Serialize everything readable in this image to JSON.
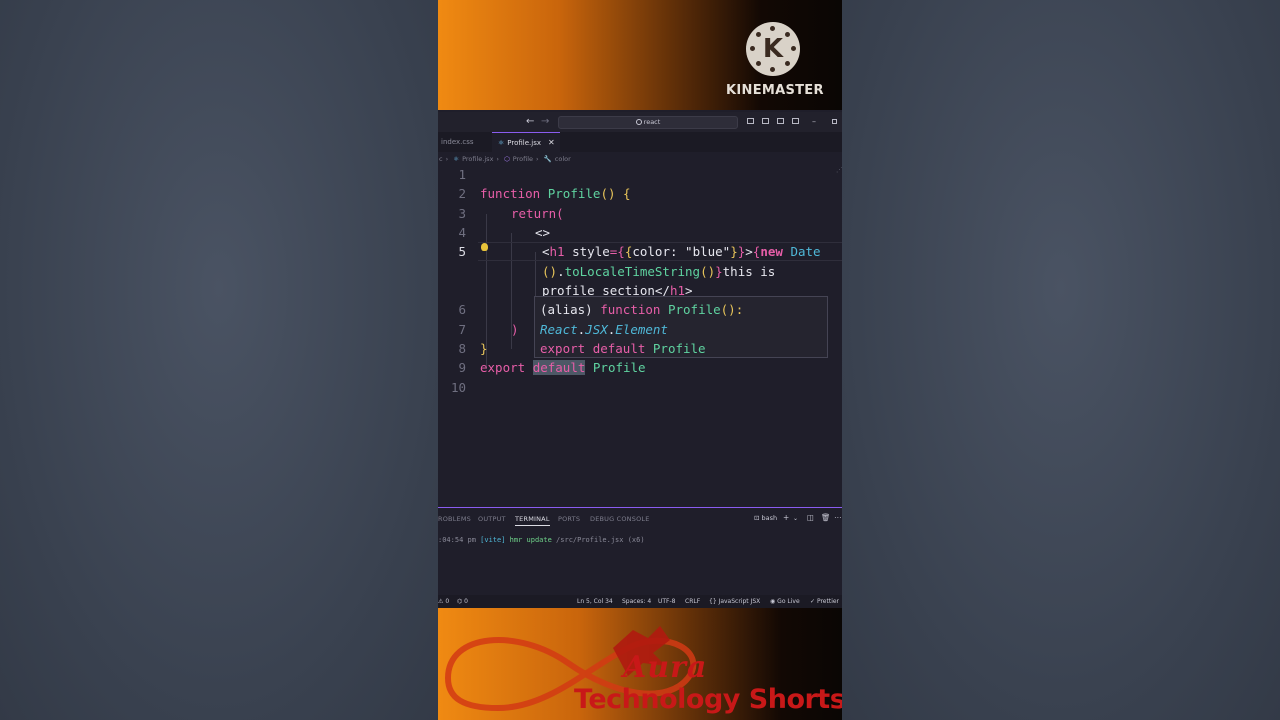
{
  "banner_top": {
    "brand": "KINEMASTER",
    "logo_letter": "K"
  },
  "titlebar": {
    "back_arrow": "←",
    "forward_arrow": "→",
    "search_text": "react",
    "minimize": "–"
  },
  "tabs": [
    {
      "label": "index.css"
    },
    {
      "label": "Profile.jsx",
      "close": "✕"
    }
  ],
  "breadcrumb": {
    "root": "c",
    "sep": "›",
    "file": "Profile.jsx",
    "symbol": "Profile",
    "property": "color"
  },
  "editor": {
    "line_numbers": [
      "1",
      "2",
      "3",
      "4",
      "5",
      "6",
      "7",
      "8",
      "9",
      "10"
    ],
    "active_line": "5",
    "line2": {
      "kw": "function",
      "fn": "Profile",
      "paren": "()",
      "brace": "{"
    },
    "line3": {
      "kw": "return",
      "paren": "("
    },
    "line4": {
      "frag": "<>"
    },
    "line5a": {
      "lt": "<",
      "tag": "h1",
      "attr": "style",
      "eq": "=",
      "ob": "{",
      "ob2": "{",
      "key": "color: \"blue\"",
      "cb2": "}",
      "cb": "}",
      "gt": ">",
      "ob3": "{",
      "kw_new": "new",
      "cls": "Date"
    },
    "line5b": {
      "parens": "()",
      "dot": ".",
      "method": "toLocaleTimeString",
      "call": "()",
      "cb": "}",
      "text": "this is"
    },
    "line5c": {
      "text": "profile section",
      "close_lt": "</",
      "tag": "h1",
      "gt": ">"
    },
    "line7": {
      "paren": ")"
    },
    "line8": {
      "brace": "}"
    },
    "line9": {
      "kw1": "export",
      "kw2": "default",
      "name": "Profile"
    },
    "hover": {
      "alias": "(alias)",
      "kw": "function",
      "name": "Profile",
      "sig": "():",
      "type_ns": "React",
      "dot1": ".",
      "type_mid": "JSX",
      "dot2": ".",
      "type_end": "Element",
      "kw_export": "export",
      "kw_default": "default",
      "export_name": "Profile"
    }
  },
  "panel": {
    "tabs": [
      "ROBLEMS",
      "OUTPUT",
      "TERMINAL",
      "PORTS",
      "DEBUG CONSOLE"
    ],
    "active_tab": "TERMINAL",
    "shell": "bash",
    "terminal_time": ":04:54 pm",
    "terminal_tag": "[vite]",
    "terminal_msg": "hmr update",
    "terminal_path": "/src/Profile.jsx",
    "terminal_count": "(x6)"
  },
  "statusbar": {
    "errors": "0",
    "ports": "0",
    "position": "Ln 5, Col 34",
    "spaces": "Spaces: 4",
    "encoding": "UTF-8",
    "eol": "CRLF",
    "language": "JavaScript JSX",
    "golive": "Go Live",
    "prettier": "Prettier"
  },
  "banner_bottom": {
    "title": "Aura",
    "subtitle": "Technology Shorts"
  },
  "colors": {
    "accent": "#8a5cf0",
    "keyword": "#e75ea8",
    "function": "#5fd3a0",
    "bracket": "#e8c55a",
    "type": "#4fb8d8"
  }
}
